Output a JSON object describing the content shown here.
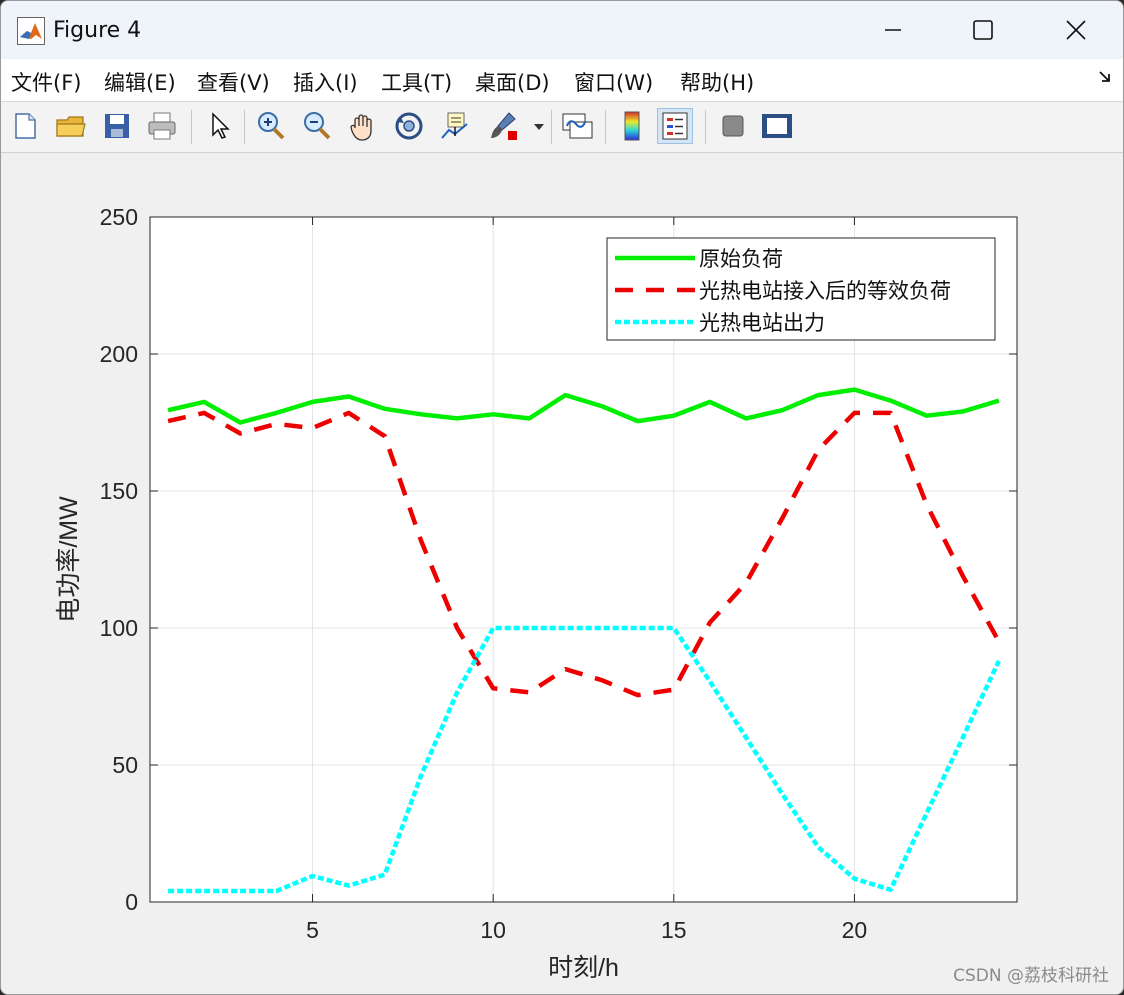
{
  "window": {
    "title": "Figure 4",
    "minimize_icon": "minimize-icon",
    "maximize_icon": "maximize-icon",
    "close_icon": "close-icon"
  },
  "menu": {
    "items": [
      "文件(F)",
      "编辑(E)",
      "查看(V)",
      "插入(I)",
      "工具(T)",
      "桌面(D)",
      "窗口(W)",
      "帮助(H)"
    ]
  },
  "toolbar": {
    "icons": [
      "new-file-icon",
      "open-folder-icon",
      "save-icon",
      "print-icon",
      "pointer-icon",
      "zoom-in-icon",
      "zoom-out-icon",
      "pan-hand-icon",
      "rotate-3d-icon",
      "data-cursor-icon",
      "brush-icon",
      "link-plot-icon",
      "colorbar-icon",
      "legend-icon",
      "hide-plot-tools-icon",
      "show-plot-tools-icon"
    ]
  },
  "colors": {
    "original_load": "#00ee00",
    "equivalent_load": "#ee0000",
    "csp_output": "#00ffff"
  },
  "chart_data": {
    "type": "line",
    "xlabel": "时刻/h",
    "ylabel": "电功率/MW",
    "xlim": [
      0.5,
      24.5
    ],
    "ylim": [
      0,
      250
    ],
    "xticks": [
      5,
      10,
      15,
      20
    ],
    "yticks": [
      0,
      50,
      100,
      150,
      200,
      250
    ],
    "grid": true,
    "legend_position": "top-right",
    "x": [
      1,
      2,
      3,
      4,
      5,
      6,
      7,
      8,
      9,
      10,
      11,
      12,
      13,
      14,
      15,
      16,
      17,
      18,
      19,
      20,
      21,
      22,
      23,
      24
    ],
    "series": [
      {
        "name": "原始负荷",
        "style": "solid",
        "color": "#00ee00",
        "values": [
          179.5,
          182.5,
          175,
          178.5,
          182.5,
          184.5,
          180,
          178,
          176.5,
          178,
          176.5,
          185,
          181,
          175.5,
          177.5,
          182.5,
          176.5,
          179.5,
          185,
          187,
          183,
          177.5,
          179,
          183
        ]
      },
      {
        "name": "光热电站接入后的等效负荷",
        "style": "dashed",
        "color": "#ee0000",
        "values": [
          175.5,
          178.5,
          171,
          174.5,
          173,
          178.5,
          170,
          132,
          100,
          78,
          76.5,
          85,
          81,
          75.5,
          77.5,
          102,
          116.5,
          140,
          165,
          178.5,
          178.5,
          145,
          119,
          95
        ]
      },
      {
        "name": "光热电站出力",
        "style": "dotted",
        "color": "#00ffff",
        "values": [
          4,
          4,
          4,
          4,
          9.5,
          6,
          10,
          46,
          76.5,
          100,
          100,
          100,
          100,
          100,
          100,
          80.5,
          60,
          39.5,
          20,
          8.5,
          4.5,
          32.5,
          60,
          88
        ]
      }
    ]
  },
  "watermark": "CSDN @荔枝科研社"
}
